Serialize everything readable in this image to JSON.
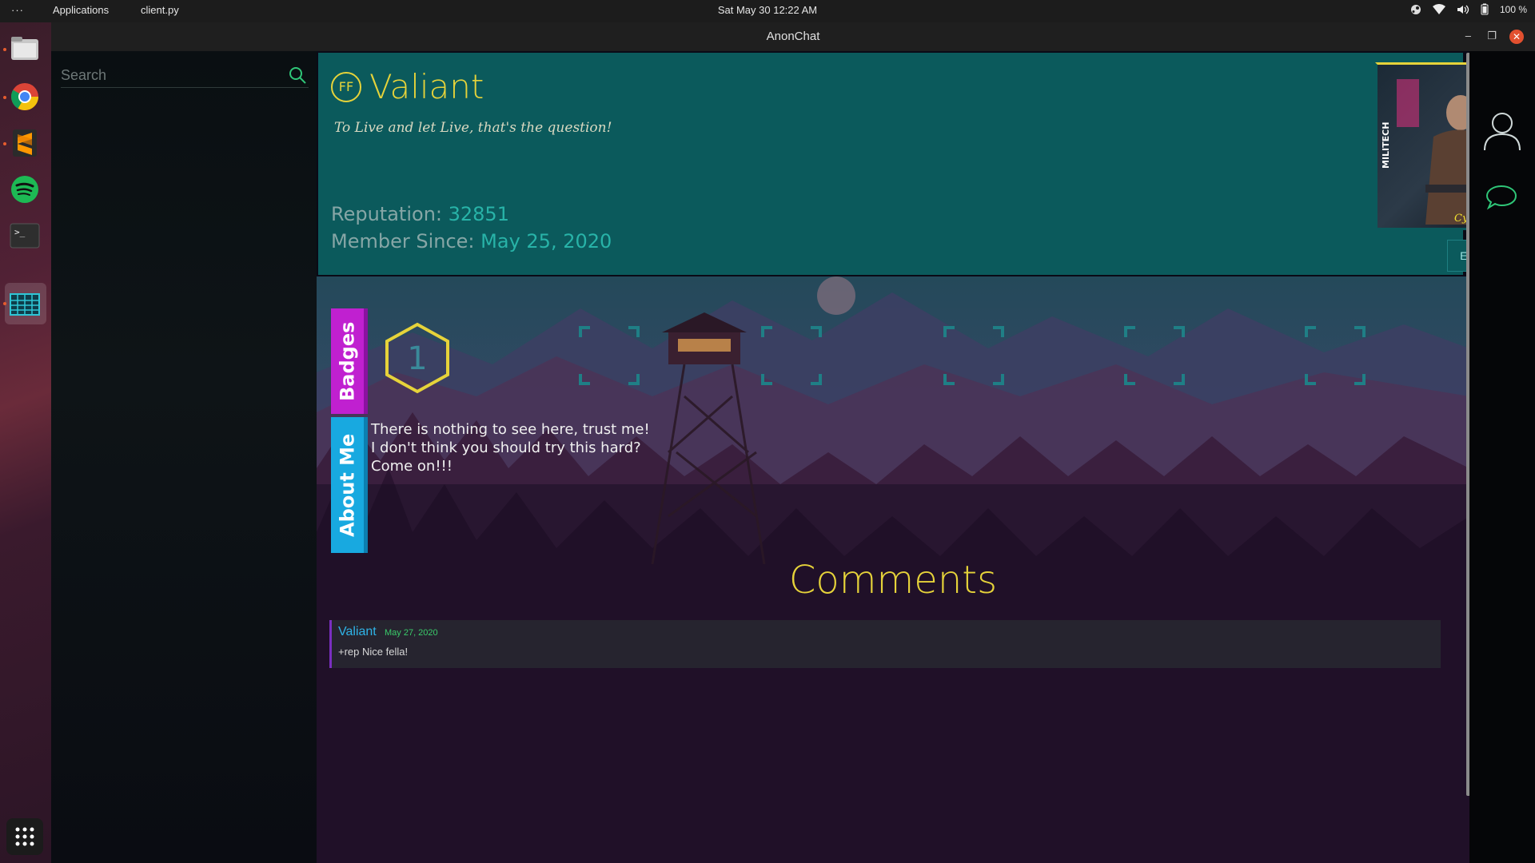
{
  "system": {
    "menu_dots": "···",
    "applications": "Applications",
    "app_name": "client.py",
    "clock": "Sat May 30  12:22 AM",
    "battery": "100 %"
  },
  "window": {
    "title": "AnonChat"
  },
  "search": {
    "placeholder": "Search",
    "value": ""
  },
  "profile": {
    "badge_initials": "FF",
    "username": "Valiant",
    "tagline": "To Live and let Live, that's the question!",
    "reputation_label": "Reputation:",
    "reputation_value": "32851",
    "member_since_label": "Member Since:",
    "member_since_value": "May 25, 2020",
    "avatar_side_text": "MILITECH",
    "avatar_brand_text": "Cyberpunk",
    "edit_button": "Edit Profile"
  },
  "tabs": {
    "badges": "Badges",
    "about": "About Me"
  },
  "badges": {
    "first_badge_label": "1",
    "empty_slots": 5
  },
  "about": {
    "lines": [
      "There is nothing to see here, trust me!",
      "I don't think you should try this hard?",
      "Come on!!!"
    ]
  },
  "comments": {
    "title": "Comments",
    "items": [
      {
        "author": "Valiant",
        "date": "May 27, 2020",
        "body": "+rep Nice fella!"
      }
    ]
  },
  "colors": {
    "accent_yellow": "#e6d33a",
    "header_teal": "#0b5a5c",
    "badges_tab": "#c020d0",
    "about_tab": "#18a9e0",
    "comment_author": "#2fb3e6",
    "comment_date": "#3acb6a"
  },
  "icons": {
    "dock": [
      "files-icon",
      "chrome-icon",
      "sublime-text-icon",
      "spotify-icon",
      "terminal-icon",
      "spreadsheet-app-icon",
      "show-apps-grid-icon"
    ],
    "tray": [
      "steam-icon",
      "wifi-icon",
      "volume-icon",
      "battery-icon"
    ],
    "right_panel": [
      "user-profile-icon",
      "chat-bubble-icon"
    ]
  }
}
